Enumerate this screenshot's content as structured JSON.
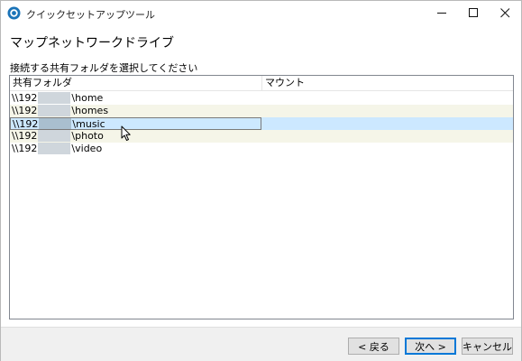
{
  "window": {
    "title": "クイックセットアップツール"
  },
  "page": {
    "title": "マップネットワークドライブ",
    "instruction": "接続する共有フォルダを選択してください"
  },
  "list": {
    "columns": [
      "共有フォルダ",
      "マウント"
    ],
    "rows": [
      {
        "prefix": "\\\\192",
        "suffix": "\\home",
        "mount": "",
        "selected": false
      },
      {
        "prefix": "\\\\192",
        "suffix": "\\homes",
        "mount": "",
        "selected": false
      },
      {
        "prefix": "\\\\192",
        "suffix": "\\music",
        "mount": "",
        "selected": true
      },
      {
        "prefix": "\\\\192",
        "suffix": "\\photo",
        "mount": "",
        "selected": false
      },
      {
        "prefix": "\\\\192",
        "suffix": "\\video",
        "mount": "",
        "selected": false
      }
    ]
  },
  "buttons": {
    "back": "< 戻る",
    "next": "次へ >",
    "cancel": "キャンセル"
  },
  "icons": {
    "app": "app-logo-icon",
    "minimize": "minimize-icon",
    "maximize": "maximize-icon",
    "close": "close-icon",
    "cursor": "mouse-pointer-icon"
  },
  "colors": {
    "selection": "#cce8ff",
    "alt_row": "#f5f5e8",
    "default_button_border": "#0078d7",
    "footer": "#f0f0f0"
  }
}
